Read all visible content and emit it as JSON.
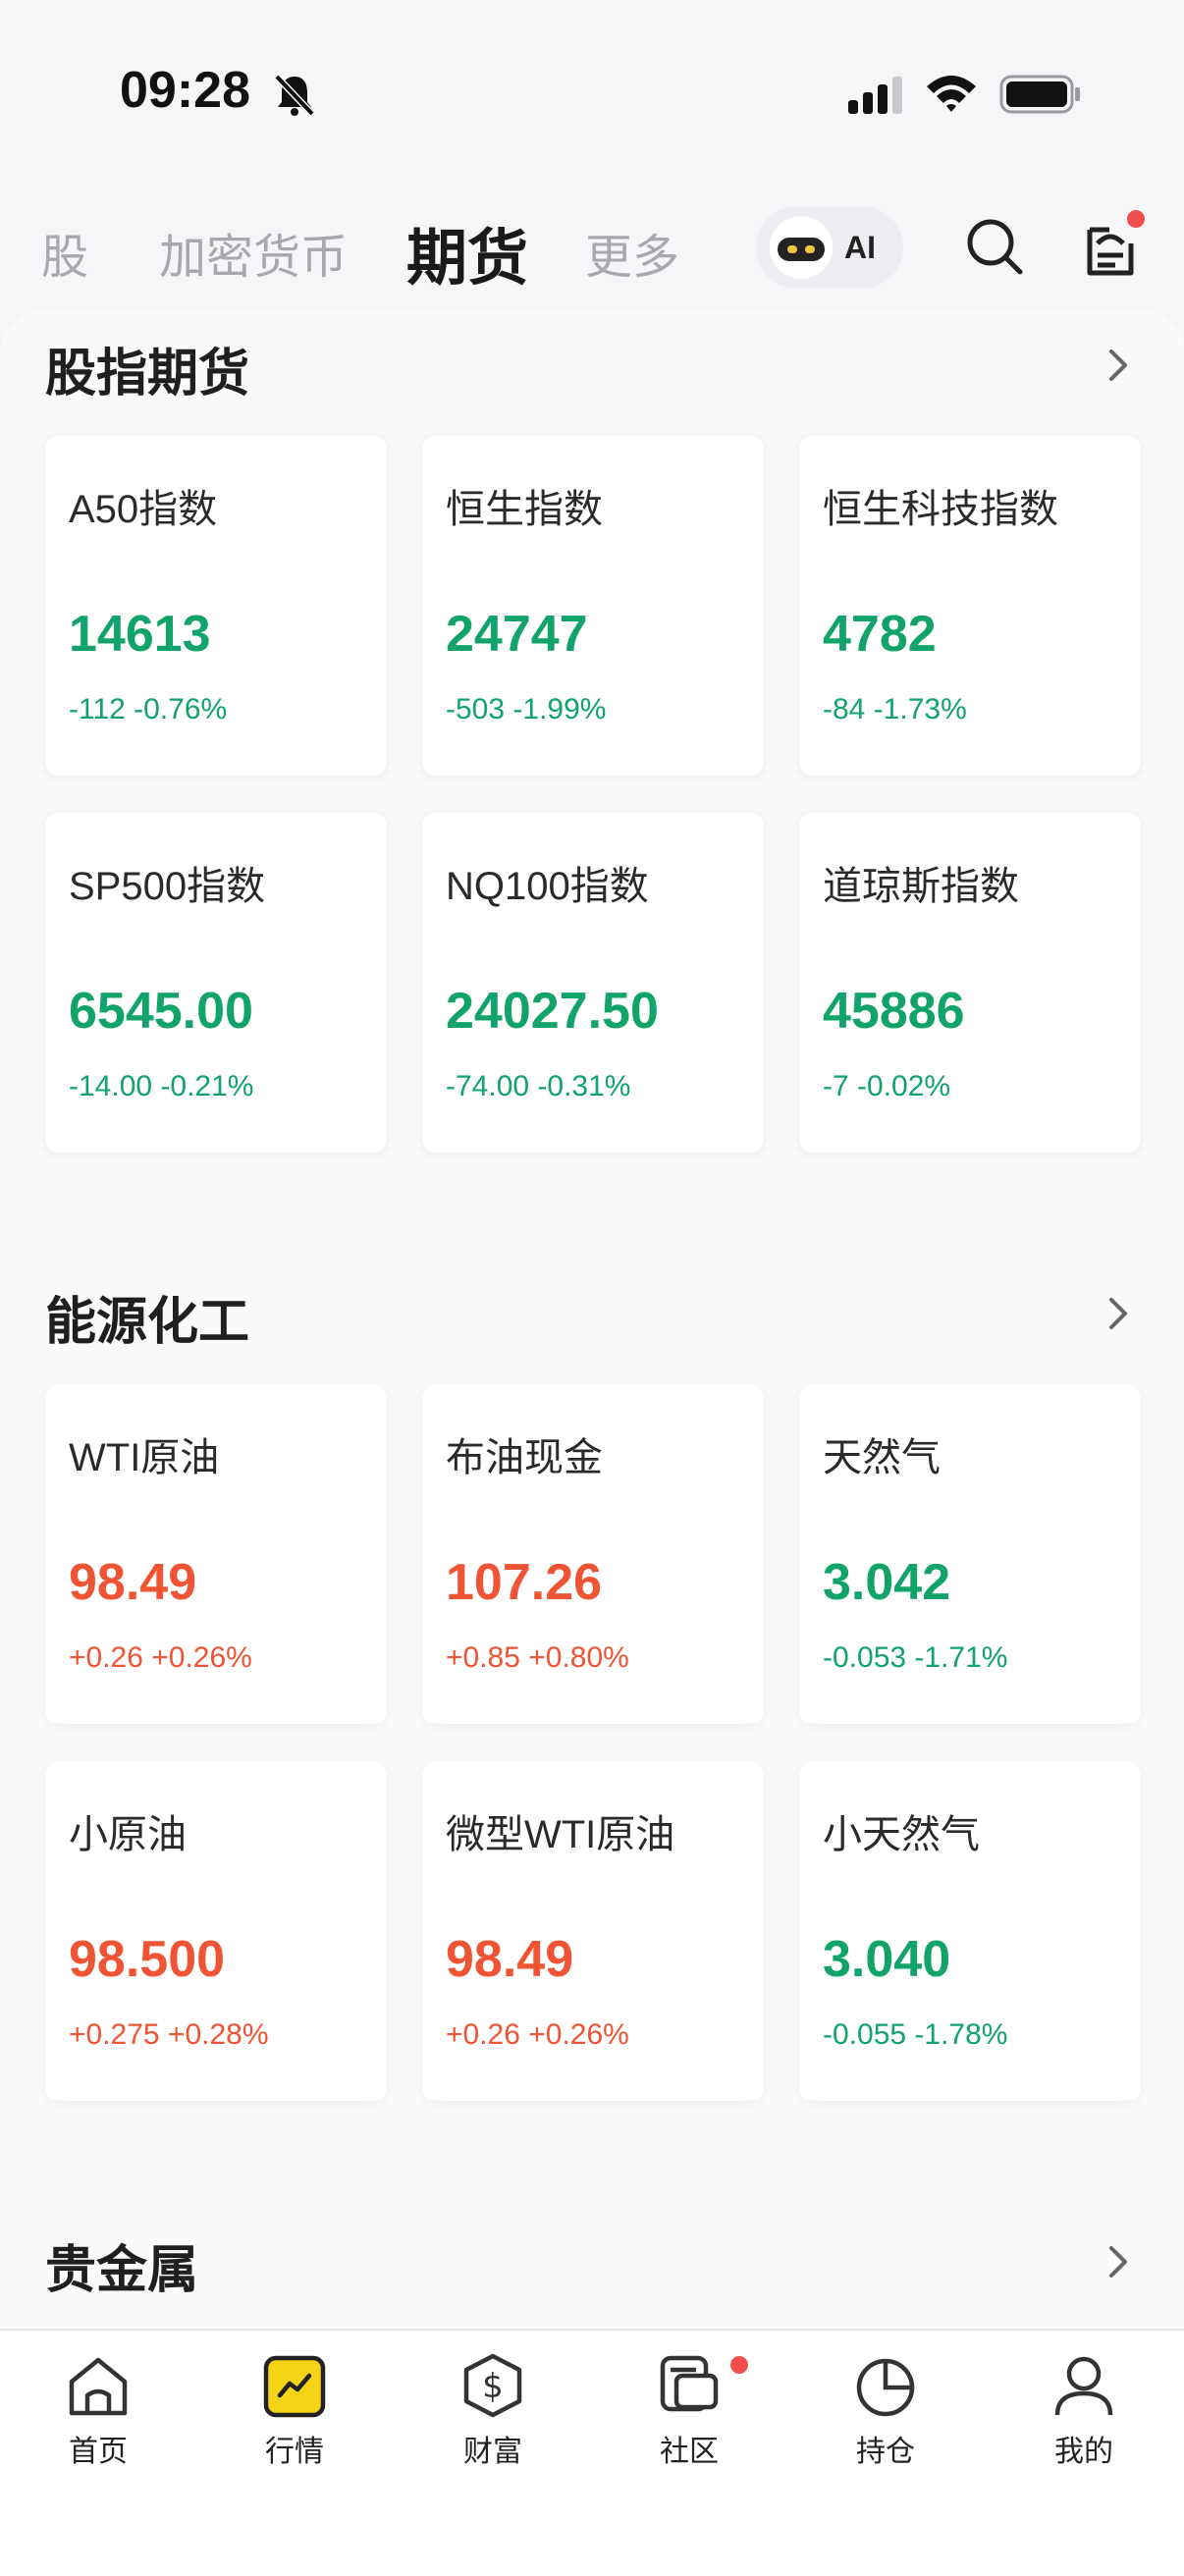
{
  "status_bar": {
    "time": "09:28"
  },
  "top_tabs": {
    "stocks": "股",
    "crypto": "加密货币",
    "futures": "期货",
    "more": "更多"
  },
  "ai_button": {
    "label": "AI"
  },
  "sections": [
    {
      "title": "股指期货",
      "cards": [
        {
          "name": "A50指数",
          "price": "14613",
          "change": "-112 -0.76%",
          "trend": "down"
        },
        {
          "name": "恒生指数",
          "price": "24747",
          "change": "-503 -1.99%",
          "trend": "down"
        },
        {
          "name": "恒生科技指数",
          "price": "4782",
          "change": "-84 -1.73%",
          "trend": "down"
        },
        {
          "name": "SP500指数",
          "price": "6545.00",
          "change": "-14.00 -0.21%",
          "trend": "down"
        },
        {
          "name": "NQ100指数",
          "price": "24027.50",
          "change": "-74.00 -0.31%",
          "trend": "down"
        },
        {
          "name": "道琼斯指数",
          "price": "45886",
          "change": "-7 -0.02%",
          "trend": "down"
        }
      ]
    },
    {
      "title": "能源化工",
      "cards": [
        {
          "name": "WTI原油",
          "price": "98.49",
          "change": "+0.26 +0.26%",
          "trend": "up"
        },
        {
          "name": "布油现金",
          "price": "107.26",
          "change": "+0.85 +0.80%",
          "trend": "up"
        },
        {
          "name": "天然气",
          "price": "3.042",
          "change": "-0.053 -1.71%",
          "trend": "down"
        },
        {
          "name": "小原油",
          "price": "98.500",
          "change": "+0.275 +0.28%",
          "trend": "up"
        },
        {
          "name": "微型WTI原油",
          "price": "98.49",
          "change": "+0.26 +0.26%",
          "trend": "up"
        },
        {
          "name": "小天然气",
          "price": "3.040",
          "change": "-0.055 -1.78%",
          "trend": "down"
        }
      ]
    },
    {
      "title": "贵金属"
    }
  ],
  "bottom_nav": [
    {
      "label": "首页",
      "icon": "home-icon"
    },
    {
      "label": "行情",
      "icon": "market-icon"
    },
    {
      "label": "财富",
      "icon": "wealth-icon"
    },
    {
      "label": "社区",
      "icon": "community-icon"
    },
    {
      "label": "持仓",
      "icon": "portfolio-icon"
    },
    {
      "label": "我的",
      "icon": "profile-icon"
    }
  ],
  "colors": {
    "up": "#ef5434",
    "down": "#12a36b",
    "accent": "#f5d316",
    "badge": "#f04d4d"
  }
}
